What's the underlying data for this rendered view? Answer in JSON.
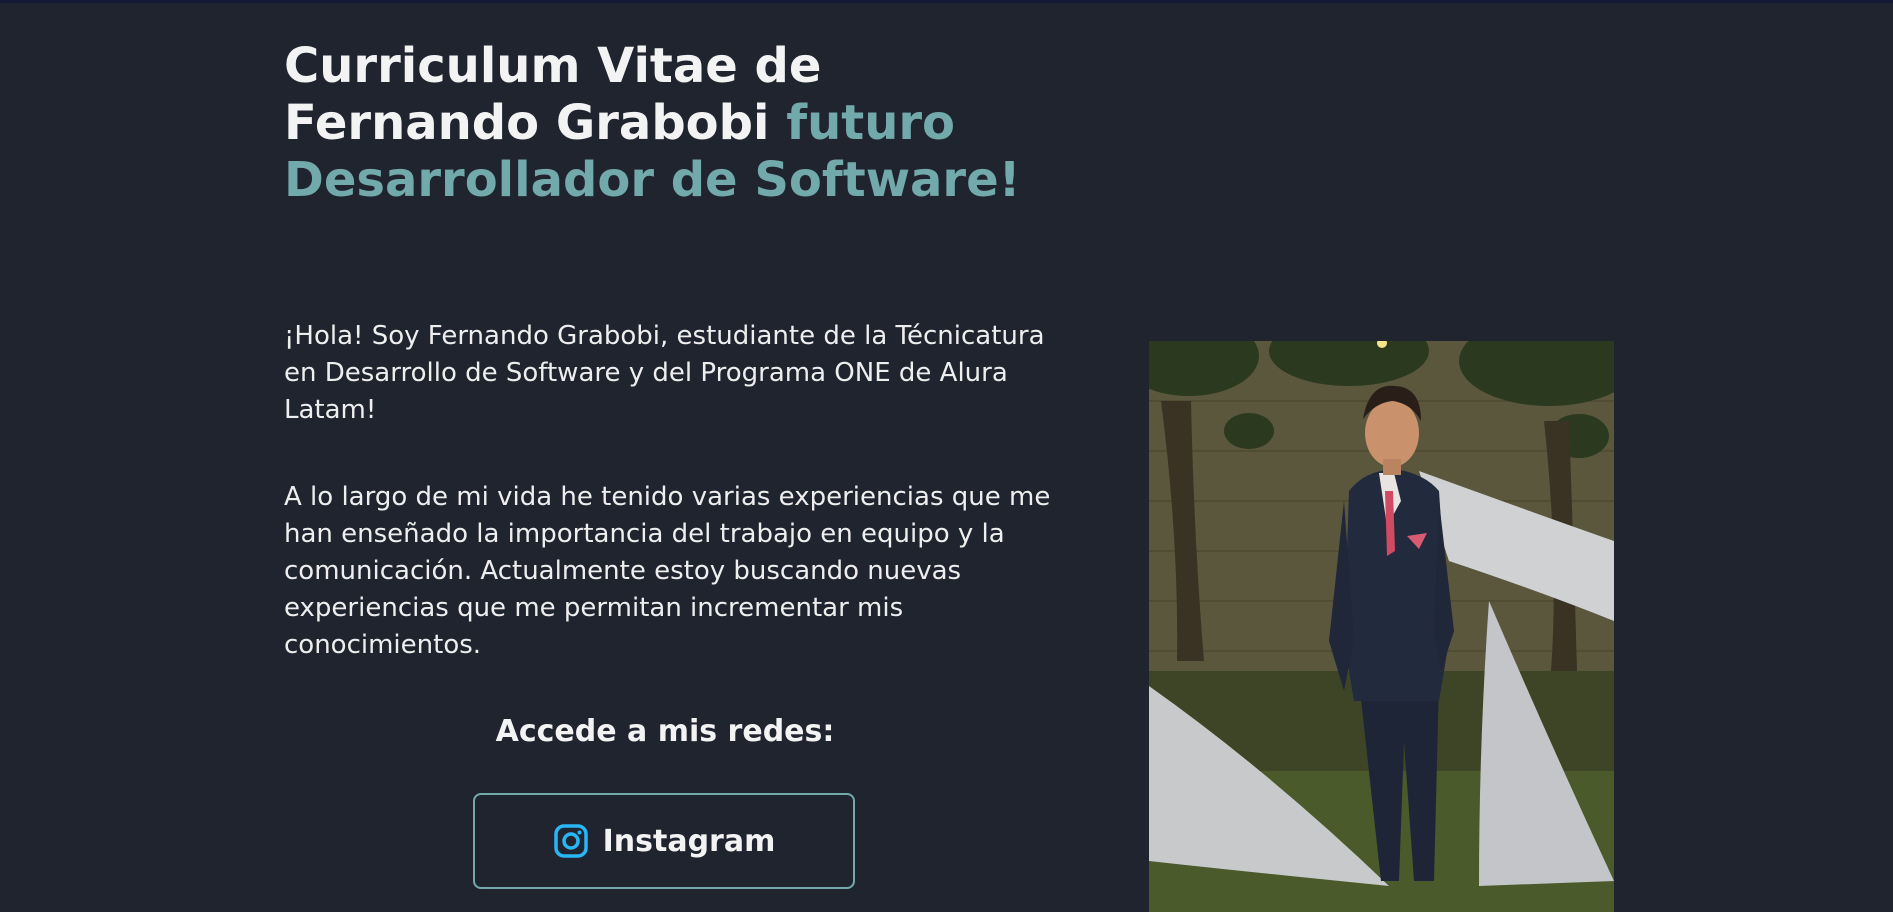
{
  "header": {
    "title_main": "Curriculum Vitae de Fernando Grabobi",
    "title_accent": "futuro Desarrollador de Software!"
  },
  "about": {
    "paragraph_1": "¡Hola! Soy Fernando Grabobi, estudiante de la Técnicatura en Desarrollo de Software y del Programa ONE de Alura Latam!",
    "paragraph_2": "A lo largo de mi vida he tenido varias experiencias que me han enseñado la importancia del trabajo en equipo y la comunicación. Actualmente estoy buscando nuevas experiencias que me permitan incrementar mis conocimientos."
  },
  "networks": {
    "heading": "Accede a mis redes:",
    "instagram_label": "Instagram",
    "instagram_icon": "instagram-icon"
  },
  "colors": {
    "background": "#20242f",
    "text": "#f3f3f3",
    "accent": "#72a9ab",
    "icon": "#29b6f6"
  }
}
